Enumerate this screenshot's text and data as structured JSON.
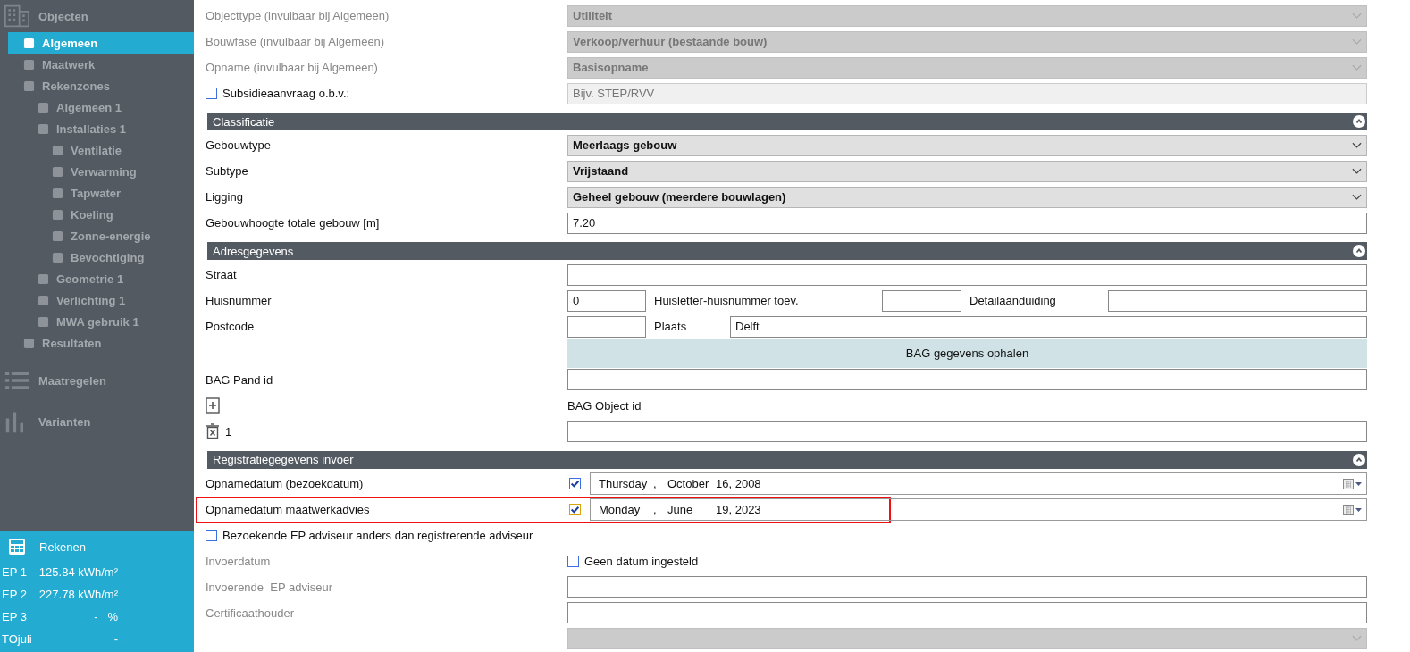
{
  "sidebar": {
    "sections": [
      {
        "label": "Objecten",
        "items": [
          {
            "label": "Algemeen",
            "selected": true
          },
          {
            "label": "Maatwerk",
            "selected": false
          },
          {
            "label": "Rekenzones",
            "selected": false,
            "children": [
              {
                "label": "Algemeen 1",
                "selected": false
              },
              {
                "label": "Installaties 1",
                "selected": false,
                "children": [
                  {
                    "label": "Ventilatie",
                    "selected": false
                  },
                  {
                    "label": "Verwarming",
                    "selected": false
                  },
                  {
                    "label": "Tapwater",
                    "selected": false
                  },
                  {
                    "label": "Koeling",
                    "selected": false
                  },
                  {
                    "label": "Zonne-energie",
                    "selected": false
                  },
                  {
                    "label": "Bevochtiging",
                    "selected": false
                  }
                ]
              },
              {
                "label": "Geometrie 1",
                "selected": false
              },
              {
                "label": "Verlichting 1",
                "selected": false
              },
              {
                "label": "MWA gebruik 1",
                "selected": false
              }
            ]
          },
          {
            "label": "Resultaten",
            "selected": false
          }
        ]
      },
      {
        "label": "Maatregelen"
      },
      {
        "label": "Varianten"
      }
    ],
    "calc": {
      "label": "Rekenen",
      "metrics": [
        {
          "label": "EP 1",
          "value": "125.84 kWh/m²"
        },
        {
          "label": "EP 2",
          "value": "227.78 kWh/m²"
        },
        {
          "label": "EP 3",
          "value": "-   %"
        },
        {
          "label": "TOjuli",
          "value": "-"
        }
      ]
    }
  },
  "form": {
    "top_rows": [
      {
        "kind": "select",
        "label": "Objecttype (invulbaar bij Algemeen)",
        "value": "Utiliteit",
        "disabled": true
      },
      {
        "kind": "select",
        "label": "Bouwfase (invulbaar bij Algemeen)",
        "value": "Verkoop/verhuur (bestaande bouw)",
        "disabled": true
      },
      {
        "kind": "select",
        "label": "Opname (invulbaar bij Algemeen)",
        "value": "Basisopname",
        "disabled": true
      },
      {
        "kind": "check_input",
        "label": "Subsidieaanvraag o.b.v.:",
        "checked": false,
        "placeholder": "Bijv. STEP/RVV",
        "disabled": true
      }
    ],
    "sections": [
      {
        "title": "Classificatie",
        "expanded": true,
        "rows": [
          {
            "kind": "select",
            "label": "Gebouwtype",
            "value": "Meerlaags gebouw",
            "disabled": false
          },
          {
            "kind": "select",
            "label": "Subtype",
            "value": "Vrijstaand",
            "disabled": false
          },
          {
            "kind": "select",
            "label": "Ligging",
            "value": "Geheel gebouw (meerdere bouwlagen)",
            "disabled": false
          },
          {
            "kind": "input",
            "label": "Gebouwhoogte totale gebouw [m]",
            "value": "7.20"
          }
        ]
      },
      {
        "title": "Adresgegevens",
        "expanded": true,
        "rows": [
          {
            "kind": "input",
            "label": "Straat"
          },
          {
            "kind": "house",
            "label": "Huisnummer",
            "value": "0",
            "label_2": "Huisletter-huisnummer toev.",
            "label_3": "Detailaanduiding"
          },
          {
            "kind": "postcode",
            "label": "Postcode",
            "label_2": "Plaats",
            "value_2": "Delft"
          },
          {
            "kind": "button",
            "text": "BAG gegevens ophalen"
          },
          {
            "kind": "input",
            "label": "BAG Pand id"
          },
          {
            "kind": "add",
            "label": "BAG Object id"
          },
          {
            "kind": "delete",
            "label": "1"
          }
        ]
      },
      {
        "title": "Registratiegegevens invoer",
        "expanded": true,
        "rows": [
          {
            "kind": "date",
            "label": "Opnamedatum (bezoekdatum)",
            "checked": true,
            "highlighted": false,
            "weekday": "Thursday",
            "separator": ",",
            "month": "October",
            "day_year": "16, 2008"
          },
          {
            "kind": "date",
            "label": "Opnamedatum maatwerkadvies",
            "checked": true,
            "highlighted": true,
            "weekday": "Monday",
            "separator": ",",
            "month": "June",
            "day_year": "19, 2023"
          },
          {
            "kind": "check",
            "label": "Bezoekende EP adviseur anders dan registrerende adviseur",
            "checked": false
          },
          {
            "kind": "label_check",
            "label": "Invoerdatum",
            "disabled": true,
            "checked": false,
            "check_label": "Geen datum ingesteld"
          },
          {
            "kind": "input",
            "label": "Invoerende  EP adviseur",
            "disabled": true
          },
          {
            "kind": "input",
            "label": "Certificaathouder",
            "disabled": true
          },
          {
            "kind": "select",
            "disabled": true
          }
        ]
      }
    ]
  }
}
